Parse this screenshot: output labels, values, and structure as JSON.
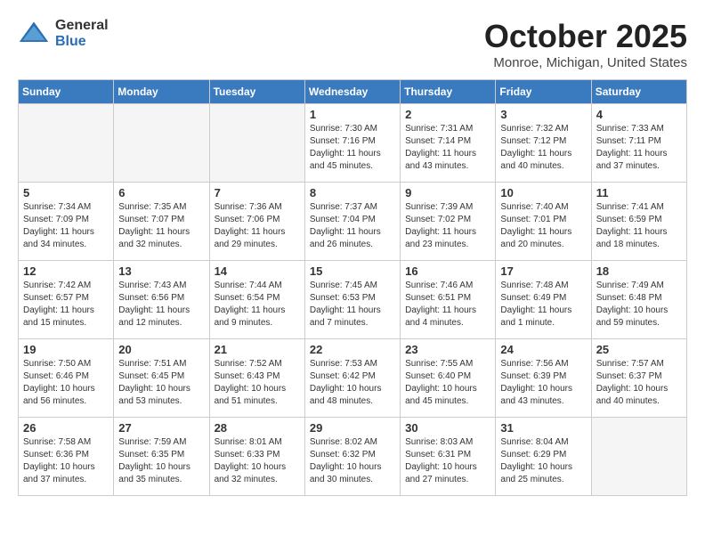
{
  "header": {
    "logo_general": "General",
    "logo_blue": "Blue",
    "month": "October 2025",
    "location": "Monroe, Michigan, United States"
  },
  "weekdays": [
    "Sunday",
    "Monday",
    "Tuesday",
    "Wednesday",
    "Thursday",
    "Friday",
    "Saturday"
  ],
  "weeks": [
    [
      {
        "day": "",
        "info": ""
      },
      {
        "day": "",
        "info": ""
      },
      {
        "day": "",
        "info": ""
      },
      {
        "day": "1",
        "info": "Sunrise: 7:30 AM\nSunset: 7:16 PM\nDaylight: 11 hours\nand 45 minutes."
      },
      {
        "day": "2",
        "info": "Sunrise: 7:31 AM\nSunset: 7:14 PM\nDaylight: 11 hours\nand 43 minutes."
      },
      {
        "day": "3",
        "info": "Sunrise: 7:32 AM\nSunset: 7:12 PM\nDaylight: 11 hours\nand 40 minutes."
      },
      {
        "day": "4",
        "info": "Sunrise: 7:33 AM\nSunset: 7:11 PM\nDaylight: 11 hours\nand 37 minutes."
      }
    ],
    [
      {
        "day": "5",
        "info": "Sunrise: 7:34 AM\nSunset: 7:09 PM\nDaylight: 11 hours\nand 34 minutes."
      },
      {
        "day": "6",
        "info": "Sunrise: 7:35 AM\nSunset: 7:07 PM\nDaylight: 11 hours\nand 32 minutes."
      },
      {
        "day": "7",
        "info": "Sunrise: 7:36 AM\nSunset: 7:06 PM\nDaylight: 11 hours\nand 29 minutes."
      },
      {
        "day": "8",
        "info": "Sunrise: 7:37 AM\nSunset: 7:04 PM\nDaylight: 11 hours\nand 26 minutes."
      },
      {
        "day": "9",
        "info": "Sunrise: 7:39 AM\nSunset: 7:02 PM\nDaylight: 11 hours\nand 23 minutes."
      },
      {
        "day": "10",
        "info": "Sunrise: 7:40 AM\nSunset: 7:01 PM\nDaylight: 11 hours\nand 20 minutes."
      },
      {
        "day": "11",
        "info": "Sunrise: 7:41 AM\nSunset: 6:59 PM\nDaylight: 11 hours\nand 18 minutes."
      }
    ],
    [
      {
        "day": "12",
        "info": "Sunrise: 7:42 AM\nSunset: 6:57 PM\nDaylight: 11 hours\nand 15 minutes."
      },
      {
        "day": "13",
        "info": "Sunrise: 7:43 AM\nSunset: 6:56 PM\nDaylight: 11 hours\nand 12 minutes."
      },
      {
        "day": "14",
        "info": "Sunrise: 7:44 AM\nSunset: 6:54 PM\nDaylight: 11 hours\nand 9 minutes."
      },
      {
        "day": "15",
        "info": "Sunrise: 7:45 AM\nSunset: 6:53 PM\nDaylight: 11 hours\nand 7 minutes."
      },
      {
        "day": "16",
        "info": "Sunrise: 7:46 AM\nSunset: 6:51 PM\nDaylight: 11 hours\nand 4 minutes."
      },
      {
        "day": "17",
        "info": "Sunrise: 7:48 AM\nSunset: 6:49 PM\nDaylight: 11 hours\nand 1 minute."
      },
      {
        "day": "18",
        "info": "Sunrise: 7:49 AM\nSunset: 6:48 PM\nDaylight: 10 hours\nand 59 minutes."
      }
    ],
    [
      {
        "day": "19",
        "info": "Sunrise: 7:50 AM\nSunset: 6:46 PM\nDaylight: 10 hours\nand 56 minutes."
      },
      {
        "day": "20",
        "info": "Sunrise: 7:51 AM\nSunset: 6:45 PM\nDaylight: 10 hours\nand 53 minutes."
      },
      {
        "day": "21",
        "info": "Sunrise: 7:52 AM\nSunset: 6:43 PM\nDaylight: 10 hours\nand 51 minutes."
      },
      {
        "day": "22",
        "info": "Sunrise: 7:53 AM\nSunset: 6:42 PM\nDaylight: 10 hours\nand 48 minutes."
      },
      {
        "day": "23",
        "info": "Sunrise: 7:55 AM\nSunset: 6:40 PM\nDaylight: 10 hours\nand 45 minutes."
      },
      {
        "day": "24",
        "info": "Sunrise: 7:56 AM\nSunset: 6:39 PM\nDaylight: 10 hours\nand 43 minutes."
      },
      {
        "day": "25",
        "info": "Sunrise: 7:57 AM\nSunset: 6:37 PM\nDaylight: 10 hours\nand 40 minutes."
      }
    ],
    [
      {
        "day": "26",
        "info": "Sunrise: 7:58 AM\nSunset: 6:36 PM\nDaylight: 10 hours\nand 37 minutes."
      },
      {
        "day": "27",
        "info": "Sunrise: 7:59 AM\nSunset: 6:35 PM\nDaylight: 10 hours\nand 35 minutes."
      },
      {
        "day": "28",
        "info": "Sunrise: 8:01 AM\nSunset: 6:33 PM\nDaylight: 10 hours\nand 32 minutes."
      },
      {
        "day": "29",
        "info": "Sunrise: 8:02 AM\nSunset: 6:32 PM\nDaylight: 10 hours\nand 30 minutes."
      },
      {
        "day": "30",
        "info": "Sunrise: 8:03 AM\nSunset: 6:31 PM\nDaylight: 10 hours\nand 27 minutes."
      },
      {
        "day": "31",
        "info": "Sunrise: 8:04 AM\nSunset: 6:29 PM\nDaylight: 10 hours\nand 25 minutes."
      },
      {
        "day": "",
        "info": ""
      }
    ]
  ]
}
